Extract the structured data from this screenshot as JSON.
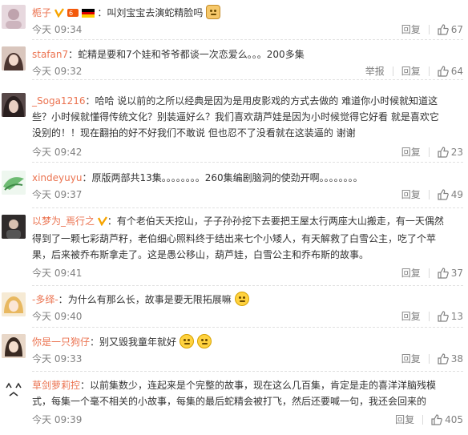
{
  "comments": [
    {
      "username": "栀子",
      "text": "叫刘宝宝去演蛇精脸吗",
      "time": "今天 09:34",
      "reply": "回复",
      "likes": "67",
      "avatar_color": "#d8c6cf"
    },
    {
      "username": "stafan7",
      "text": "蛇精是要和7个娃和爷爷都谈一次恋爱么。。。200多集",
      "time": "今天 09:32",
      "report": "举报",
      "likes": "64",
      "avatar_color": "#b89a8f"
    },
    {
      "username": "_Soga1216",
      "text_lines": [
        "哈哈 说以前的之所以经典是因为是用皮影戏的方式去做的 难道你小时候就知道这",
        "些？小时候就懂得传统文化？别装逼好么？我们喜欢葫芦娃是因为小时候觉得它好看 就是喜欢它",
        "没别的！！现在翻拍的好不好我们不敢说 但也忍不了没看就在这装逼的 谢谢"
      ],
      "time": "今天 09:42",
      "reply": "回复",
      "likes": "23",
      "avatar_color": "#7a6a6a"
    },
    {
      "username": "xindeyuyu",
      "text": "原版两部共13集。。。。。。。。260集编剧脑洞的使劲开啊。。。。。。。。",
      "time": "今天 09:37",
      "reply": "回复",
      "likes": "49",
      "avatar_color": "#7fc48a"
    },
    {
      "username": "以梦为_焉行之",
      "text_lines": [
        "有个老伯天天挖山，子子孙孙挖下去要把王屋太行两座大山搬走，有一天偶然",
        "得到了一颗七彩葫芦籽，老伯细心照料终于结出来七个小矮人，有天解救了白雪公主，吃了个苹",
        "果，后来被乔布斯拿走了。这是愚公移山，葫芦娃，白雪公主和乔布斯的故事。"
      ],
      "time": "今天 09:41",
      "reply": "回复",
      "likes": "37",
      "avatar_color": "#3a3a3a"
    },
    {
      "username": "-多绎-",
      "text": "为什么有那么长，故事是要无限拓展嘛",
      "time": "今天 09:40",
      "reply": "回复",
      "likes": "13",
      "avatar_color": "#e6c48a"
    },
    {
      "username": "你是一只狗仔",
      "text": "别又毁我童年就好",
      "time": "今天 09:33",
      "reply": "回复",
      "likes": "38",
      "avatar_color": "#c9a68a"
    },
    {
      "username": "草剑萝莉控",
      "text_lines": [
        "以前集数少，连起来是个完整的故事，现在这么几百集，肯定是走的喜洋洋脑残模",
        "式，每集一个毫不相关的小故事，每集的最后蛇精会被打飞，然后还要喊一句，我还会回来的"
      ],
      "time": "今天 09:39",
      "reply": "回复",
      "likes": "405",
      "avatar_text": "^ ^\n/\\",
      "avatar_color": "#ffffff"
    }
  ],
  "colors": {
    "accent": "#eb7350",
    "muted": "#808080",
    "text": "#333333"
  }
}
